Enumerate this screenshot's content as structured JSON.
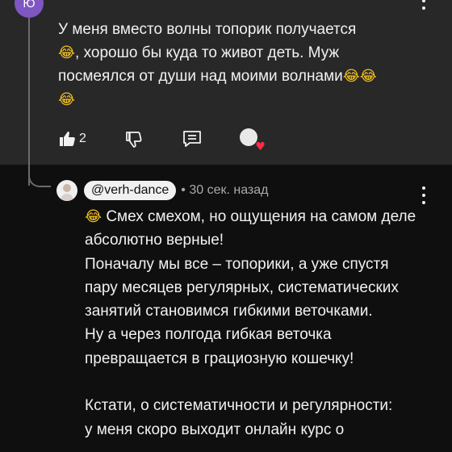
{
  "top_comment": {
    "avatar_letter": "Ю",
    "lines": [
      {
        "text": "У меня вместо волны топорик получается"
      },
      {
        "emoji_before": "😂",
        "text": ", хорошо бы куда то живот деть. Муж"
      },
      {
        "text": "посмеялся от души над моими волнами",
        "emoji_after": "😂😂"
      },
      {
        "emoji_before": "😂",
        "text": ""
      }
    ],
    "like_count": "2",
    "icons": {
      "like": "thumbs-up-icon",
      "dislike": "thumbs-down-icon",
      "reply": "reply-icon",
      "creator_heart": "creator-heart-icon"
    }
  },
  "reply": {
    "author_handle": "@verh-dance",
    "timestamp": "• 30 сек. назад",
    "emoji_lead": "😂",
    "paragraphs": [
      " Смех смехом, но ощущения на самом деле абсолютно верные!",
      "Поначалу мы все – топорики, а уже спустя пару месяцев регулярных, систематических занятий становимся гибкими веточками.",
      "Ну а через полгода гибкая веточка превращается в грациозную кошечку!",
      "",
      "Кстати, о систематичности и регулярности:"
    ],
    "clipped_line": "у меня скоро выходит онлайн курс о"
  },
  "colors": {
    "top_background": "#282828",
    "bottom_background": "#0f0f0f",
    "text": "#f1f1f1",
    "secondary_text": "#aaaaaa",
    "heart": "#ff2b4a",
    "avatar": "#7e57c2"
  }
}
